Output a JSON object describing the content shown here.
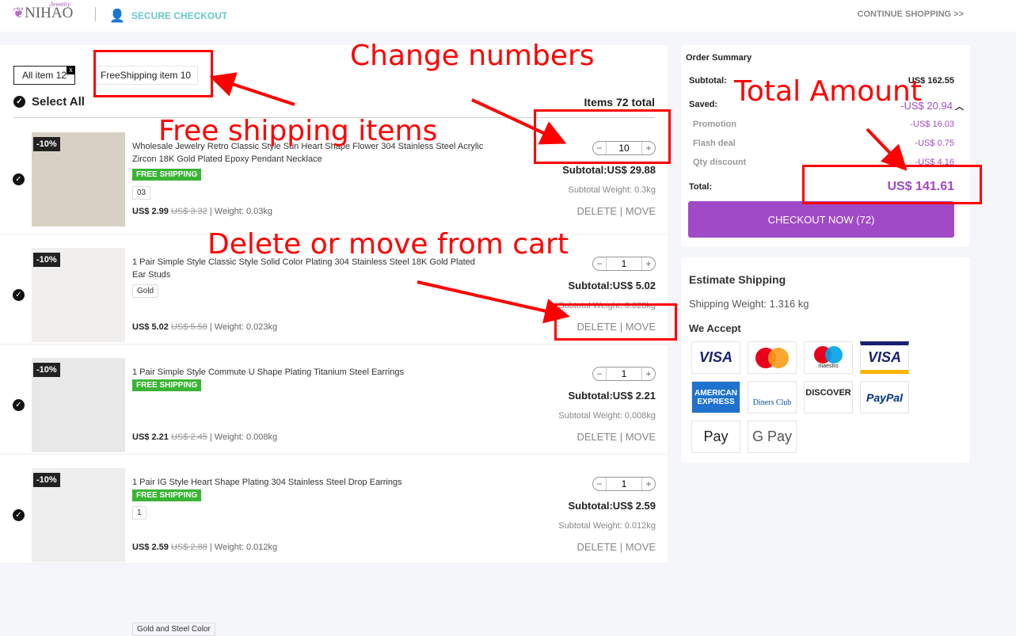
{
  "header": {
    "logo": "NIHAO",
    "logo_script": "Jewelry",
    "secure": "SECURE CHECKOUT",
    "continue": "CONTINUE SHOPPING >>"
  },
  "tabs": [
    {
      "label": "All item 12",
      "close": "x"
    },
    {
      "label": "FreeShipping item 10"
    }
  ],
  "select_all": "Select All",
  "items_total": "Items 72 total",
  "items": [
    {
      "badge": "-10%",
      "title": "Wholesale Jewelry Retro Classic Style Sun Heart Shape Flower 304 Stainless Steel Acrylic Zircon 18K Gold Plated Epoxy Pendant Necklace",
      "free_shipping": "FREE SHIPPING",
      "variant": "03",
      "price": "US$ 2.99",
      "old_price": "US$ 3.32",
      "weight": "| Weight: 0.03kg",
      "qty": "10",
      "subtotal": "Subtotal:US$ 29.88",
      "subtotal_weight": "Subtotal Weight: 0.3kg"
    },
    {
      "badge": "-10%",
      "title": "1 Pair Simple Style Classic Style Solid Color Plating 304 Stainless Steel 18K Gold Plated Ear Studs",
      "free_shipping": "",
      "variant": "Gold",
      "price": "US$ 5.02",
      "old_price": "US$ 5.58",
      "weight": "| Weight: 0.023kg",
      "qty": "1",
      "subtotal": "Subtotal:US$ 5.02",
      "subtotal_weight": "Subtotal Weight: 0.023kg"
    },
    {
      "badge": "-10%",
      "title": "1 Pair Simple Style Commute U Shape Plating Titanium Steel Earrings",
      "free_shipping": "FREE SHIPPING",
      "variant": "Gold and Steel Color",
      "price": "US$ 2.21",
      "old_price": "US$ 2.45",
      "weight": "| Weight: 0.008kg",
      "qty": "1",
      "subtotal": "Subtotal:US$ 2.21",
      "subtotal_weight": "Subtotal Weight: 0.008kg"
    },
    {
      "badge": "-10%",
      "title": "1 Pair IG Style Heart Shape Plating 304 Stainless Steel Drop Earrings",
      "free_shipping": "FREE SHIPPING",
      "variant": "1",
      "price": "US$ 2.59",
      "old_price": "US$ 2.88",
      "weight": "| Weight: 0.012kg",
      "qty": "1",
      "subtotal": "Subtotal:US$ 2.59",
      "subtotal_weight": "Subtotal Weight: 0.012kg"
    }
  ],
  "actions": {
    "delete": "DELETE",
    "sep": "|",
    "move": "MOVE"
  },
  "summary": {
    "title": "Order Summary",
    "subtotal_label": "Subtotal:",
    "subtotal": "US$ 162.55",
    "saved_label": "Saved:",
    "saved": "-US$ 20.94",
    "promotion_label": "Promotion",
    "promotion": "-US$ 16.03",
    "flash_label": "Flash deal",
    "flash": "-US$ 0.75",
    "qty_label": "Qty discount",
    "qty": "-US$ 4.16",
    "total_label": "Total:",
    "total": "US$ 141.61",
    "checkout": "CHECKOUT NOW  (72)"
  },
  "shipping": {
    "title": "Estimate Shipping",
    "weight": "Shipping Weight: 1.316 kg",
    "accept": "We Accept",
    "cards": [
      "VISA",
      "Mastercard",
      "maestro",
      "VISA",
      "AMERICAN EXPRESS",
      "Diners Club",
      "DISCOVER",
      "PayPal",
      "Pay",
      "G Pay"
    ]
  },
  "annotations": {
    "change": "Change numbers",
    "total": "Total Amount",
    "free": "Free shipping items",
    "delete": "Delete or move from cart"
  },
  "colors": {
    "accent": "#a04ac8",
    "free_shipping": "#3ab435",
    "secure": "#6cc7cc",
    "annotation": "#ff0000"
  }
}
